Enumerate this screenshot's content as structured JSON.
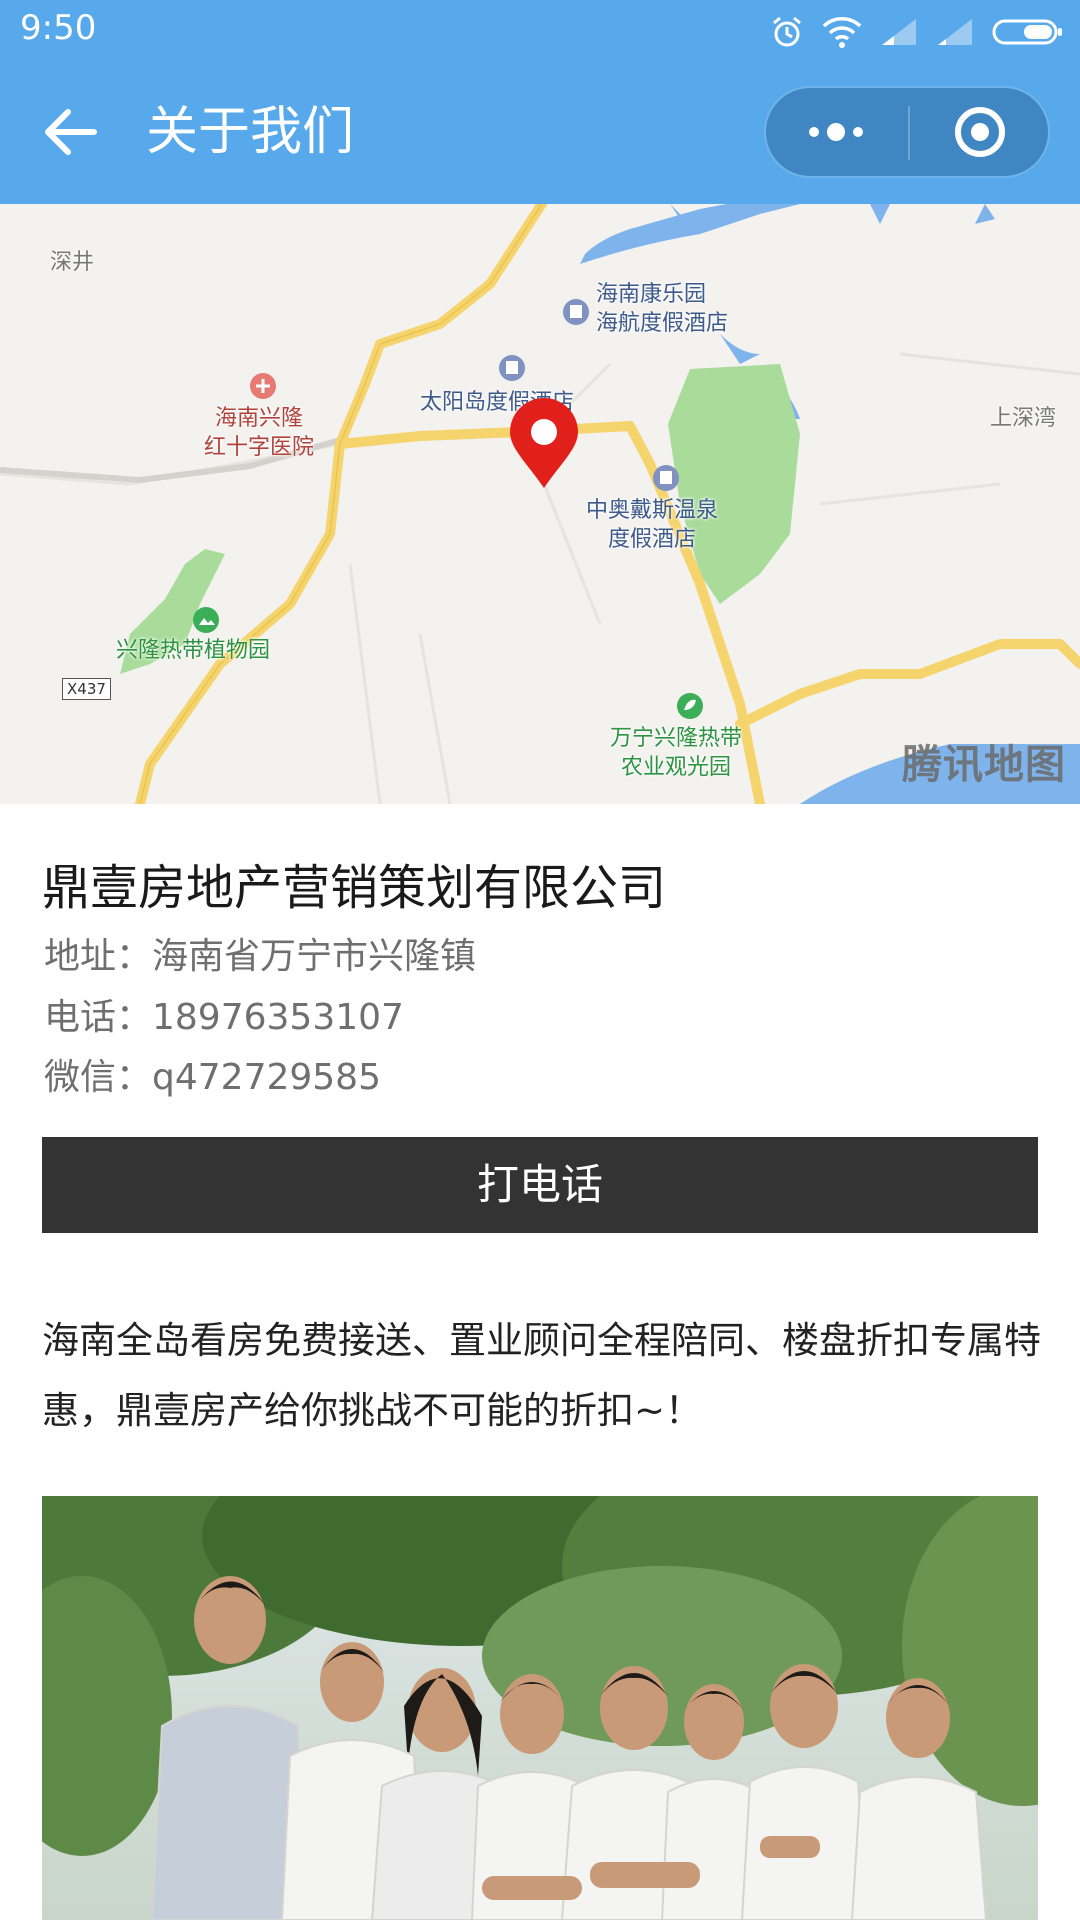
{
  "status_bar": {
    "time": "9:50",
    "icons": [
      "alarm-icon",
      "wifi-icon",
      "signal-icon",
      "signal-icon",
      "battery-icon"
    ]
  },
  "nav": {
    "title": "关于我们",
    "back_icon": "back-arrow-icon",
    "capsule": [
      "more-icon",
      "close-circle-icon"
    ]
  },
  "map": {
    "brand": "腾讯地图",
    "road_tag": "X437",
    "labels": [
      {
        "text": "深井",
        "style": "gray"
      },
      {
        "text": "海南康乐园\n海航度假酒店",
        "style": "blue"
      },
      {
        "text": "太阳岛度假酒店",
        "style": "blue"
      },
      {
        "text": "海南兴隆\n红十字医院",
        "style": "red"
      },
      {
        "text": "上深湾",
        "style": "gray"
      },
      {
        "text": "中奥戴斯温泉\n度假酒店",
        "style": "blue"
      },
      {
        "text": "兴隆热带植物园",
        "style": "green"
      },
      {
        "text": "万宁兴隆热带\n农业观光园",
        "style": "green"
      }
    ],
    "colors": {
      "road": "#f6d46d",
      "water": "#7fb3ec",
      "park": "#a9dc9a",
      "pin": "#e2201b"
    }
  },
  "company": {
    "name": "鼎壹房地产营销策划有限公司",
    "address": "地址：海南省万宁市兴隆镇",
    "phone": "电话：18976353107",
    "wechat": "微信：q472729585"
  },
  "call_button": {
    "label": "打电话"
  },
  "description": "海南全岛看房免费接送、置业顾问全程陪同、楼盘折扣专属特惠，鼎壹房产给你挑战不可能的折扣~！",
  "colors": {
    "header": "#58a9ec",
    "button": "#333333"
  }
}
